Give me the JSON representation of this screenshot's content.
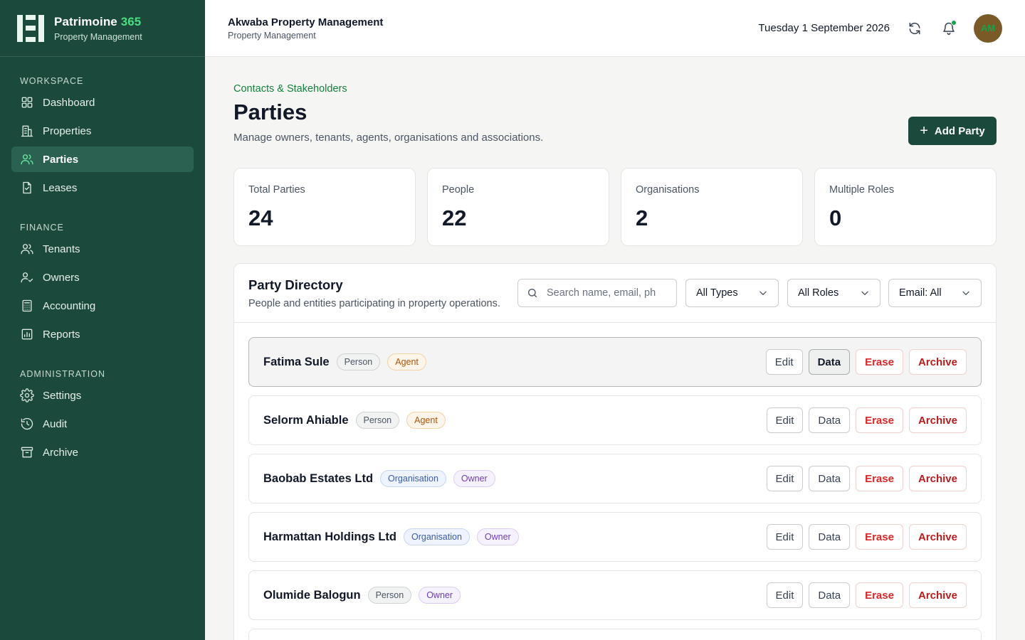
{
  "brand": {
    "name": "Patrimoine",
    "name_accent": "365",
    "subtitle": "Property Management"
  },
  "sidebar": {
    "sections": [
      {
        "heading": "WORKSPACE",
        "items": [
          {
            "label": "Dashboard",
            "icon": "grid-icon",
            "active": false
          },
          {
            "label": "Properties",
            "icon": "building-icon",
            "active": false
          },
          {
            "label": "Parties",
            "icon": "users-icon",
            "active": true
          },
          {
            "label": "Leases",
            "icon": "document-icon",
            "active": false
          }
        ]
      },
      {
        "heading": "FINANCE",
        "items": [
          {
            "label": "Tenants",
            "icon": "users-icon",
            "active": false
          },
          {
            "label": "Owners",
            "icon": "user-check-icon",
            "active": false
          },
          {
            "label": "Accounting",
            "icon": "calculator-icon",
            "active": false
          },
          {
            "label": "Reports",
            "icon": "chart-icon",
            "active": false
          }
        ]
      },
      {
        "heading": "ADMINISTRATION",
        "items": [
          {
            "label": "Settings",
            "icon": "gear-icon",
            "active": false
          },
          {
            "label": "Audit",
            "icon": "history-icon",
            "active": false
          },
          {
            "label": "Archive",
            "icon": "archive-icon",
            "active": false
          }
        ]
      }
    ]
  },
  "topbar": {
    "org_name": "Akwaba Property Management",
    "org_sub": "Property Management",
    "date": "Tuesday 1 September 2026",
    "avatar_initials": "AM",
    "has_notification": true
  },
  "page": {
    "breadcrumb": "Contacts & Stakeholders",
    "title": "Parties",
    "description": "Manage owners, tenants, agents, organisations and associations.",
    "add_label": "Add Party"
  },
  "stats": [
    {
      "label": "Total Parties",
      "value": "24"
    },
    {
      "label": "People",
      "value": "22"
    },
    {
      "label": "Organisations",
      "value": "2"
    },
    {
      "label": "Multiple Roles",
      "value": "0"
    }
  ],
  "directory": {
    "title": "Party Directory",
    "subtitle": "People and entities participating in property operations.",
    "search_placeholder": "Search name, email, ph",
    "filters": {
      "type": "All Types",
      "role": "All Roles",
      "email": "Email: All"
    },
    "actions": {
      "edit": "Edit",
      "data": "Data",
      "erase": "Erase",
      "archive": "Archive"
    },
    "rows": [
      {
        "name": "Fatima Sule",
        "type": "Person",
        "role": "Agent",
        "selected": true
      },
      {
        "name": "Selorm Ahiable",
        "type": "Person",
        "role": "Agent",
        "selected": false
      },
      {
        "name": "Baobab Estates Ltd",
        "type": "Organisation",
        "role": "Owner",
        "selected": false
      },
      {
        "name": "Harmattan Holdings Ltd",
        "type": "Organisation",
        "role": "Owner",
        "selected": false
      },
      {
        "name": "Olumide Balogun",
        "type": "Person",
        "role": "Owner",
        "selected": false
      }
    ]
  },
  "colors": {
    "sidebar_bg": "#1b4a3c",
    "accent_green": "#15803d",
    "danger_red": "#dc2626",
    "agent_orange": "#b45309",
    "owner_purple": "#6d3fb3",
    "organisation_blue": "#3b5bab"
  }
}
